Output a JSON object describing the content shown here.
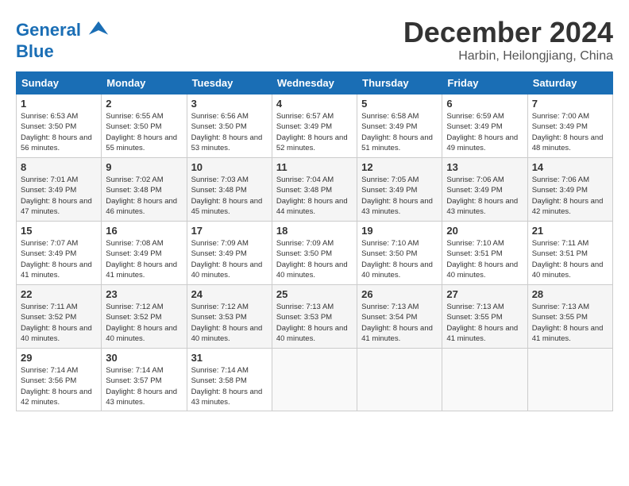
{
  "header": {
    "logo_line1": "General",
    "logo_line2": "Blue",
    "title": "December 2024",
    "subtitle": "Harbin, Heilongjiang, China"
  },
  "days_of_week": [
    "Sunday",
    "Monday",
    "Tuesday",
    "Wednesday",
    "Thursday",
    "Friday",
    "Saturday"
  ],
  "weeks": [
    [
      {
        "day": "1",
        "sunrise": "6:53 AM",
        "sunset": "3:50 PM",
        "daylight": "8 hours and 56 minutes."
      },
      {
        "day": "2",
        "sunrise": "6:55 AM",
        "sunset": "3:50 PM",
        "daylight": "8 hours and 55 minutes."
      },
      {
        "day": "3",
        "sunrise": "6:56 AM",
        "sunset": "3:50 PM",
        "daylight": "8 hours and 53 minutes."
      },
      {
        "day": "4",
        "sunrise": "6:57 AM",
        "sunset": "3:49 PM",
        "daylight": "8 hours and 52 minutes."
      },
      {
        "day": "5",
        "sunrise": "6:58 AM",
        "sunset": "3:49 PM",
        "daylight": "8 hours and 51 minutes."
      },
      {
        "day": "6",
        "sunrise": "6:59 AM",
        "sunset": "3:49 PM",
        "daylight": "8 hours and 49 minutes."
      },
      {
        "day": "7",
        "sunrise": "7:00 AM",
        "sunset": "3:49 PM",
        "daylight": "8 hours and 48 minutes."
      }
    ],
    [
      {
        "day": "8",
        "sunrise": "7:01 AM",
        "sunset": "3:49 PM",
        "daylight": "8 hours and 47 minutes."
      },
      {
        "day": "9",
        "sunrise": "7:02 AM",
        "sunset": "3:48 PM",
        "daylight": "8 hours and 46 minutes."
      },
      {
        "day": "10",
        "sunrise": "7:03 AM",
        "sunset": "3:48 PM",
        "daylight": "8 hours and 45 minutes."
      },
      {
        "day": "11",
        "sunrise": "7:04 AM",
        "sunset": "3:48 PM",
        "daylight": "8 hours and 44 minutes."
      },
      {
        "day": "12",
        "sunrise": "7:05 AM",
        "sunset": "3:49 PM",
        "daylight": "8 hours and 43 minutes."
      },
      {
        "day": "13",
        "sunrise": "7:06 AM",
        "sunset": "3:49 PM",
        "daylight": "8 hours and 43 minutes."
      },
      {
        "day": "14",
        "sunrise": "7:06 AM",
        "sunset": "3:49 PM",
        "daylight": "8 hours and 42 minutes."
      }
    ],
    [
      {
        "day": "15",
        "sunrise": "7:07 AM",
        "sunset": "3:49 PM",
        "daylight": "8 hours and 41 minutes."
      },
      {
        "day": "16",
        "sunrise": "7:08 AM",
        "sunset": "3:49 PM",
        "daylight": "8 hours and 41 minutes."
      },
      {
        "day": "17",
        "sunrise": "7:09 AM",
        "sunset": "3:49 PM",
        "daylight": "8 hours and 40 minutes."
      },
      {
        "day": "18",
        "sunrise": "7:09 AM",
        "sunset": "3:50 PM",
        "daylight": "8 hours and 40 minutes."
      },
      {
        "day": "19",
        "sunrise": "7:10 AM",
        "sunset": "3:50 PM",
        "daylight": "8 hours and 40 minutes."
      },
      {
        "day": "20",
        "sunrise": "7:10 AM",
        "sunset": "3:51 PM",
        "daylight": "8 hours and 40 minutes."
      },
      {
        "day": "21",
        "sunrise": "7:11 AM",
        "sunset": "3:51 PM",
        "daylight": "8 hours and 40 minutes."
      }
    ],
    [
      {
        "day": "22",
        "sunrise": "7:11 AM",
        "sunset": "3:52 PM",
        "daylight": "8 hours and 40 minutes."
      },
      {
        "day": "23",
        "sunrise": "7:12 AM",
        "sunset": "3:52 PM",
        "daylight": "8 hours and 40 minutes."
      },
      {
        "day": "24",
        "sunrise": "7:12 AM",
        "sunset": "3:53 PM",
        "daylight": "8 hours and 40 minutes."
      },
      {
        "day": "25",
        "sunrise": "7:13 AM",
        "sunset": "3:53 PM",
        "daylight": "8 hours and 40 minutes."
      },
      {
        "day": "26",
        "sunrise": "7:13 AM",
        "sunset": "3:54 PM",
        "daylight": "8 hours and 41 minutes."
      },
      {
        "day": "27",
        "sunrise": "7:13 AM",
        "sunset": "3:55 PM",
        "daylight": "8 hours and 41 minutes."
      },
      {
        "day": "28",
        "sunrise": "7:13 AM",
        "sunset": "3:55 PM",
        "daylight": "8 hours and 41 minutes."
      }
    ],
    [
      {
        "day": "29",
        "sunrise": "7:14 AM",
        "sunset": "3:56 PM",
        "daylight": "8 hours and 42 minutes."
      },
      {
        "day": "30",
        "sunrise": "7:14 AM",
        "sunset": "3:57 PM",
        "daylight": "8 hours and 43 minutes."
      },
      {
        "day": "31",
        "sunrise": "7:14 AM",
        "sunset": "3:58 PM",
        "daylight": "8 hours and 43 minutes."
      },
      null,
      null,
      null,
      null
    ]
  ]
}
